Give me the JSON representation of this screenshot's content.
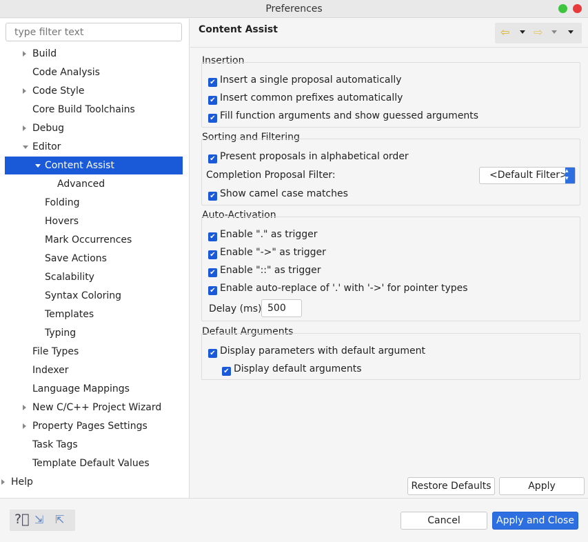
{
  "window": {
    "title": "Preferences",
    "buttons": {
      "maximize_color": "#3ec43e",
      "close_color": "#e83a3a"
    }
  },
  "filter": {
    "placeholder": "type filter text"
  },
  "tree": [
    {
      "label": "Build",
      "level": 0,
      "expander": "collapsed"
    },
    {
      "label": "Code Analysis",
      "level": 0,
      "expander": "none"
    },
    {
      "label": "Code Style",
      "level": 0,
      "expander": "collapsed"
    },
    {
      "label": "Core Build Toolchains",
      "level": 0,
      "expander": "none"
    },
    {
      "label": "Debug",
      "level": 0,
      "expander": "collapsed"
    },
    {
      "label": "Editor",
      "level": 0,
      "expander": "expanded"
    },
    {
      "label": "Content Assist",
      "level": 1,
      "expander": "expanded",
      "selected": true
    },
    {
      "label": "Advanced",
      "level": 2,
      "expander": "none"
    },
    {
      "label": "Folding",
      "level": 1,
      "expander": "none"
    },
    {
      "label": "Hovers",
      "level": 1,
      "expander": "none"
    },
    {
      "label": "Mark Occurrences",
      "level": 1,
      "expander": "none"
    },
    {
      "label": "Save Actions",
      "level": 1,
      "expander": "none"
    },
    {
      "label": "Scalability",
      "level": 1,
      "expander": "none"
    },
    {
      "label": "Syntax Coloring",
      "level": 1,
      "expander": "none"
    },
    {
      "label": "Templates",
      "level": 1,
      "expander": "none"
    },
    {
      "label": "Typing",
      "level": 1,
      "expander": "none"
    },
    {
      "label": "File Types",
      "level": 0,
      "expander": "none"
    },
    {
      "label": "Indexer",
      "level": 0,
      "expander": "none"
    },
    {
      "label": "Language Mappings",
      "level": 0,
      "expander": "none"
    },
    {
      "label": "New C/C++ Project Wizard",
      "level": 0,
      "expander": "collapsed"
    },
    {
      "label": "Property Pages Settings",
      "level": 0,
      "expander": "collapsed"
    },
    {
      "label": "Task Tags",
      "level": 0,
      "expander": "none"
    },
    {
      "label": "Template Default Values",
      "level": 0,
      "expander": "none"
    },
    {
      "label": "Help",
      "level": -1,
      "expander": "collapsed"
    }
  ],
  "page": {
    "title": "Content Assist"
  },
  "groups": {
    "insertion": {
      "label": "Insertion",
      "items": [
        {
          "label": "Insert a single proposal automatically",
          "checked": true
        },
        {
          "label": "Insert common prefixes automatically",
          "checked": true
        },
        {
          "label": "Fill function arguments and show guessed arguments",
          "checked": true
        }
      ]
    },
    "sorting": {
      "label": "Sorting and Filtering",
      "items": [
        {
          "label": "Present proposals in alphabetical order",
          "checked": true
        },
        {
          "label": "Show camel case matches",
          "checked": true
        }
      ],
      "filter_label": "Completion Proposal Filter:",
      "filter_value": "<Default Filter>"
    },
    "auto": {
      "label": "Auto-Activation",
      "items": [
        {
          "label": "Enable \".\" as trigger",
          "checked": true
        },
        {
          "label": "Enable \"->\" as trigger",
          "checked": true
        },
        {
          "label": "Enable \"::\" as trigger",
          "checked": true
        },
        {
          "label": "Enable auto-replace of '.' with '->' for pointer types",
          "checked": true
        }
      ],
      "delay_label": "Delay (ms)",
      "delay_value": "500"
    },
    "defaults": {
      "label": "Default Arguments",
      "items": [
        {
          "label": "Display parameters with default argument",
          "checked": true
        },
        {
          "label": "Display default arguments",
          "checked": true
        }
      ]
    }
  },
  "buttons": {
    "restore": "Restore Defaults",
    "apply": "Apply",
    "cancel": "Cancel",
    "apply_close": "Apply and Close"
  }
}
